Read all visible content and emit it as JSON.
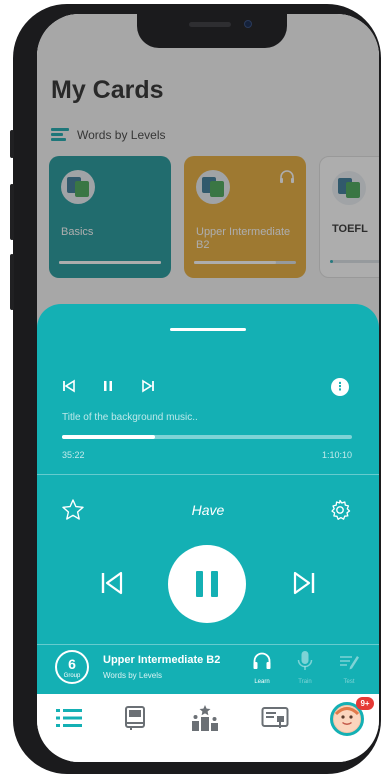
{
  "page": {
    "title": "My Cards",
    "section_label": "Words by Levels"
  },
  "cards": [
    {
      "name": "Basics",
      "progress": 1.0,
      "has_audio": false,
      "color": "#0f8f93"
    },
    {
      "name": "Upper Intermediate B2",
      "progress": 0.8,
      "has_audio": true,
      "color": "#e5a52a"
    },
    {
      "name": "TOEFL",
      "progress": 0.05,
      "has_audio": false,
      "color": "#ffffff"
    }
  ],
  "player": {
    "music_title": "Title of the background music..",
    "elapsed": "35:22",
    "total": "1:10:10",
    "progress": 0.32,
    "word": "Have",
    "accent_color": "#14b0b4"
  },
  "set": {
    "group_number": "6",
    "group_label": "Group",
    "title": "Upper Intermediate B2",
    "subtitle": "Words by Levels"
  },
  "modes": [
    {
      "label": "Learn",
      "icon": "headset-icon",
      "active": true
    },
    {
      "label": "Train",
      "icon": "microphone-icon",
      "active": false
    },
    {
      "label": "Test",
      "icon": "test-icon",
      "active": false
    }
  ],
  "tabbar": {
    "tabs": [
      "list-icon",
      "book-icon",
      "ranking-icon",
      "certificate-icon",
      "avatar"
    ],
    "notification_badge": "9+"
  }
}
